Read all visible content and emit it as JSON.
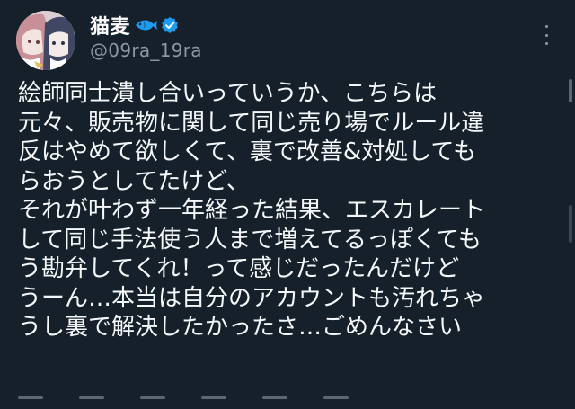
{
  "author": {
    "display_name": "猫麦",
    "handle": "@09ra_19ra",
    "verified_color": "#1d9bf0",
    "avatar_icon": "avatar"
  },
  "menu": {
    "icon": "more-icon"
  },
  "tweet": {
    "lines": [
      "絵師同士潰し合いっていうか、こちらは",
      "元々、販売物に関して同じ売り場でルール違",
      "反はやめて欲しくて、裏で改善&対処しても",
      "らおうとしてたけど、",
      "それが叶わず一年経った結果、エスカレート",
      "して同じ手法使う人まで増えてるっぽくても",
      "う勘弁してくれ！って感じだったんだけど",
      "うーん…本当は自分のアカウントも汚れちゃ",
      "うし裏で解決したかったさ…ごめんなさい"
    ]
  },
  "colors": {
    "background": "#15202b",
    "text": "#ffffff",
    "secondary": "#8b98a5",
    "fish": "#1d9bf0"
  }
}
